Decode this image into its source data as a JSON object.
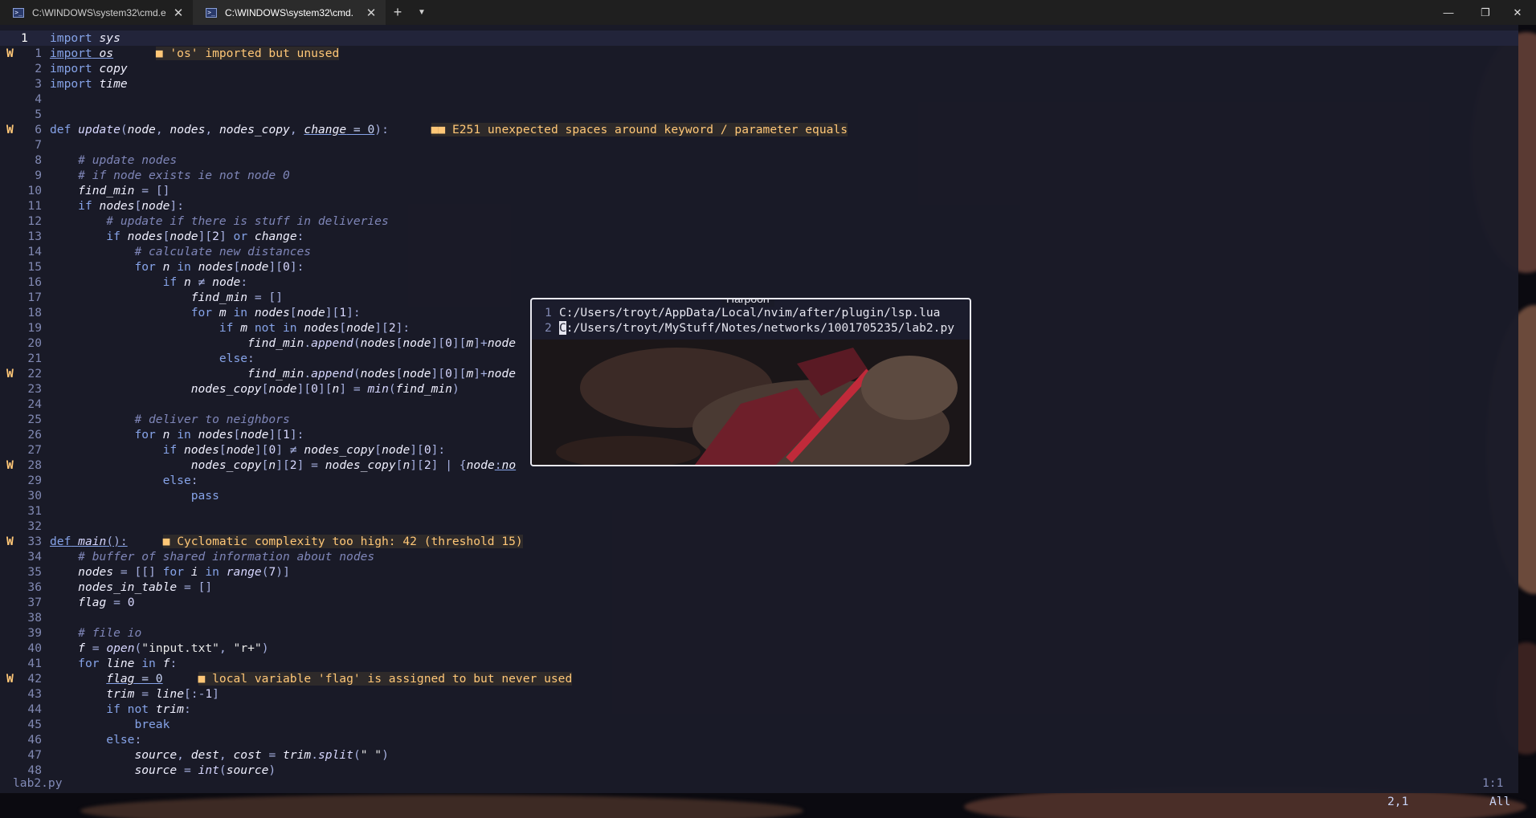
{
  "tabs": [
    {
      "title": "C:\\WINDOWS\\system32\\cmd.e",
      "icon": "terminal-icon"
    },
    {
      "title": "C:\\WINDOWS\\system32\\cmd.",
      "icon": "terminal-icon"
    }
  ],
  "window_controls": {
    "minimize": "—",
    "maximize": "❐",
    "close": "✕"
  },
  "statusline": {
    "file": "lab2.py",
    "position": "1:1"
  },
  "cmdline": {
    "cursor": "2,1",
    "scroll": "All"
  },
  "harpoon": {
    "title": "Harpoon",
    "items": [
      {
        "n": "1",
        "path": "C:/Users/troyt/AppData/Local/nvim/after/plugin/lsp.lua"
      },
      {
        "n": "2",
        "first": "C",
        "path": ":/Users/troyt/MyStuff/Notes/networks/1001705235/lab2.py"
      }
    ]
  },
  "colors": {
    "accent": "#86a3e8",
    "warning": "#ffc777",
    "comment": "#7f86b8",
    "background": "#1a1b28"
  }
}
